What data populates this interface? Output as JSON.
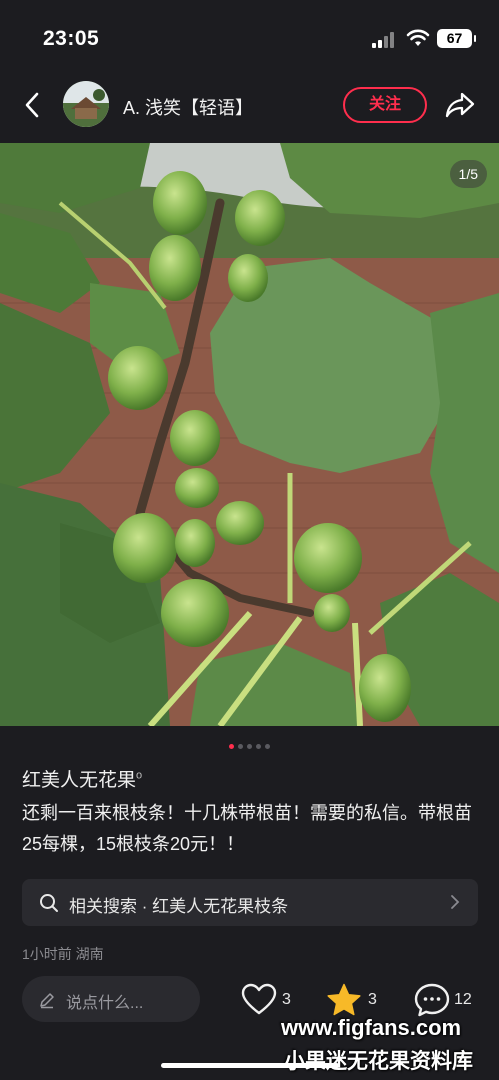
{
  "status_bar": {
    "time": "23:05",
    "battery": "67"
  },
  "header": {
    "author_name": "A. 浅笑【轻语】",
    "follow_label": "关注"
  },
  "media": {
    "page_indicator": "1/5",
    "current_page": 1,
    "total_pages": 5
  },
  "note": {
    "title": "红美人无花果",
    "title_mark": "o",
    "body": "还剩一百来根枝条！十几株带根苗！需要的私信。带根苗25每棵，15根枝条20元！！"
  },
  "related_search": {
    "label": "相关搜索 · 红美人无花果枝条"
  },
  "meta": {
    "time_location": "1小时前 湖南"
  },
  "bottom_bar": {
    "comment_placeholder": "说点什么...",
    "likes": "3",
    "favorites": "3",
    "comments": "12"
  },
  "watermark": {
    "url": "www.figfans.com",
    "name": "小果迷无花果资料库"
  },
  "colors": {
    "accent": "#ff2e4d",
    "star": "#f7b928",
    "background": "#1c1c20"
  },
  "icons": [
    "back-icon",
    "share-icon",
    "search-icon",
    "chevron-right-icon",
    "pencil-icon",
    "heart-icon",
    "star-icon",
    "comment-icon"
  ]
}
